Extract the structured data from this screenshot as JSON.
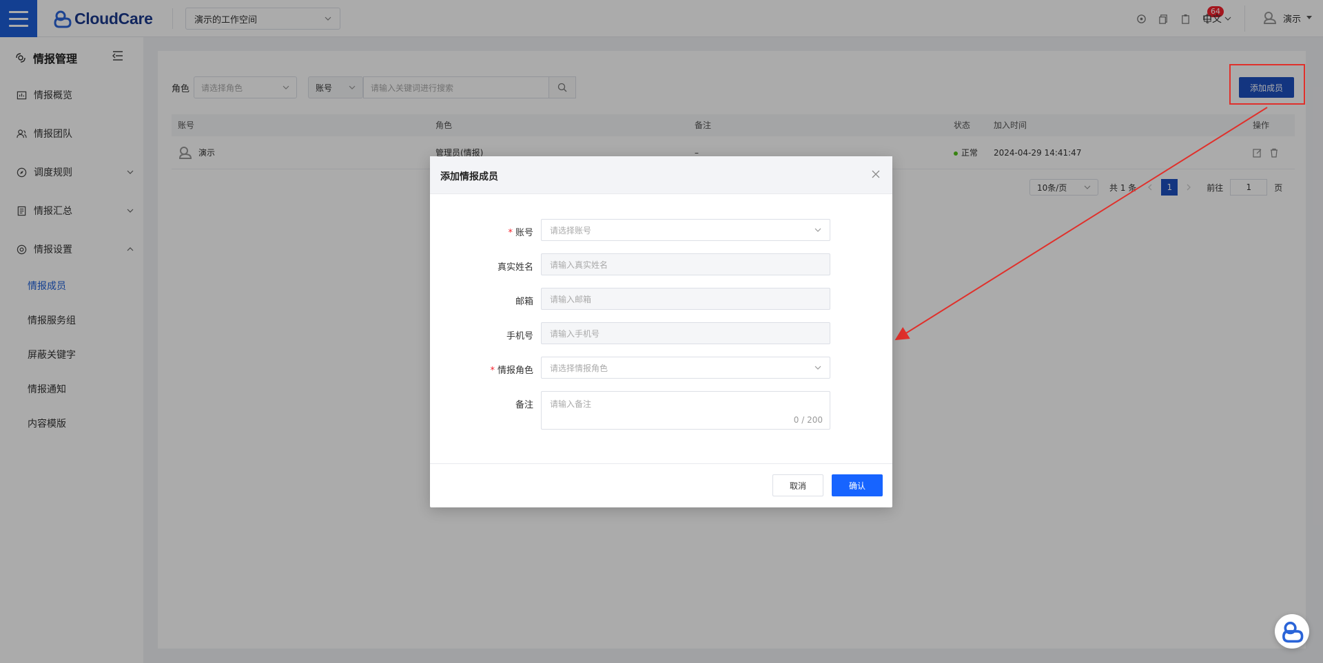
{
  "header": {
    "brand": "CloudCare",
    "workspace": "演示的工作空间",
    "notification_count": "64",
    "language": "中文",
    "user_name": "演示"
  },
  "sidebar": {
    "title": "情报管理",
    "items": [
      {
        "label": "情报概览",
        "icon": "dashboard-icon"
      },
      {
        "label": "情报团队",
        "icon": "team-icon"
      },
      {
        "label": "调度规则",
        "icon": "compass-icon"
      },
      {
        "label": "情报汇总",
        "icon": "document-icon"
      },
      {
        "label": "情报设置",
        "icon": "settings-icon"
      }
    ],
    "sub_items": [
      "情报成员",
      "情报服务组",
      "屏蔽关键字",
      "情报通知",
      "内容模版"
    ]
  },
  "filters": {
    "role_label": "角色",
    "role_placeholder": "请选择角色",
    "field_select": "账号",
    "search_placeholder": "请输入关键词进行搜索",
    "add_button": "添加成员"
  },
  "table": {
    "headers": [
      "账号",
      "角色",
      "备注",
      "状态",
      "加入时间",
      "操作"
    ],
    "rows": [
      {
        "account": "演示",
        "role": "管理员(情报)",
        "note": "–",
        "status": "正常",
        "joined": "2024-04-29 14:41:47"
      }
    ]
  },
  "pager": {
    "page_size": "10条/页",
    "total": "共 1 条",
    "current": "1",
    "goto_label": "前往",
    "goto_value": "1",
    "page_suffix": "页"
  },
  "modal": {
    "title": "添加情报成员",
    "fields": [
      {
        "label": "账号",
        "placeholder": "请选择账号",
        "required": true
      },
      {
        "label": "真实姓名",
        "placeholder": "请输入真实姓名",
        "required": false
      },
      {
        "label": "邮箱",
        "placeholder": "请输入邮箱",
        "required": false
      },
      {
        "label": "手机号",
        "placeholder": "请输入手机号",
        "required": false
      },
      {
        "label": "情报角色",
        "placeholder": "请选择情报角色",
        "required": true
      },
      {
        "label": "备注",
        "placeholder": "请输入备注",
        "required": false
      }
    ],
    "note_count": "0 / 200",
    "cancel": "取消",
    "confirm": "确认"
  },
  "colors": {
    "primary": "#1d5fd8",
    "confirm": "#1764ff",
    "annotation": "#e0302b",
    "success": "#52c41a"
  }
}
